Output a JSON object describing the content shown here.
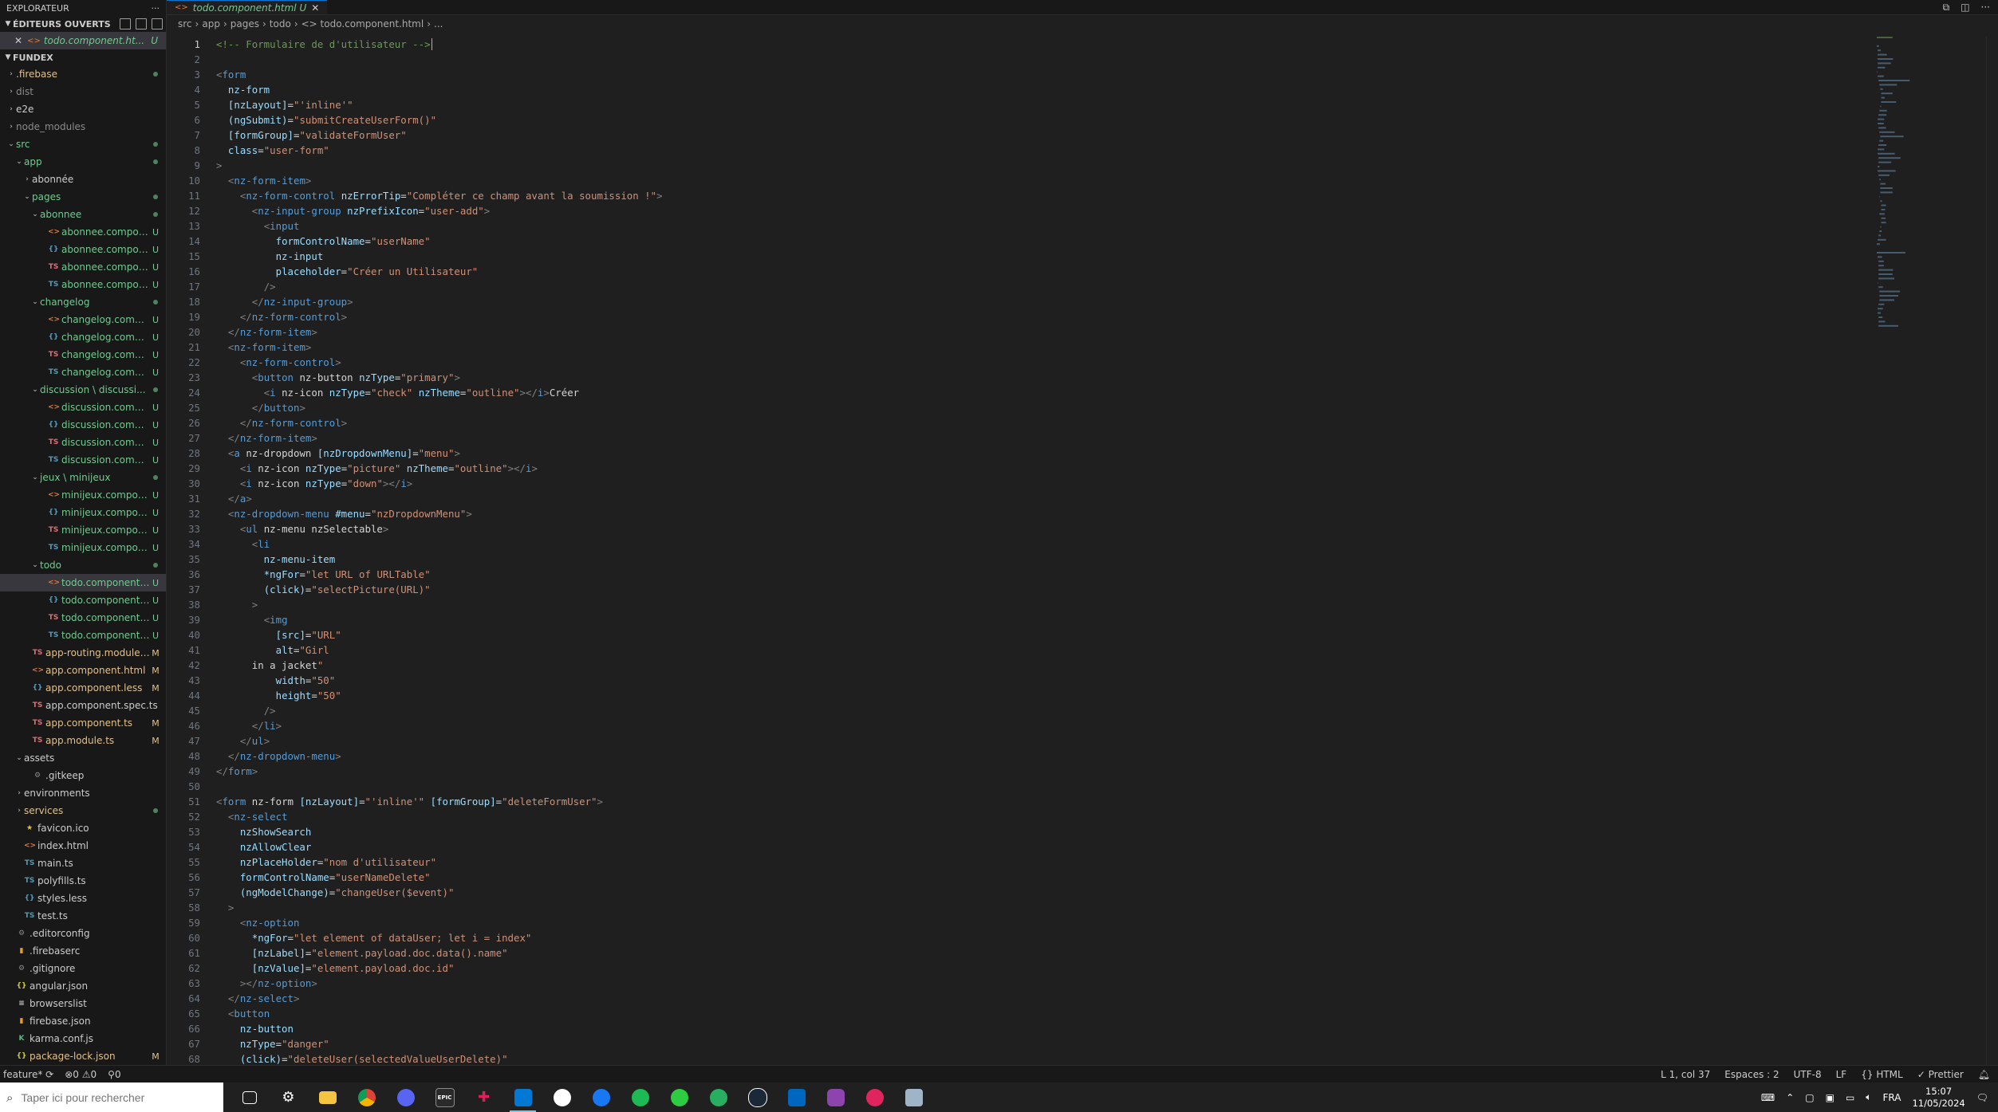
{
  "sidebar": {
    "title": "EXPLORATEUR",
    "open_editors_label": "ÉDITEURS OUVERTS",
    "open_editor_file": "todo.component.ht...",
    "open_editor_badge": "U",
    "project_label": "FUNDEX"
  },
  "tree": [
    {
      "depth": 0,
      "type": "folder",
      "label": ".firebase",
      "color": "mod",
      "dot": true,
      "open": false
    },
    {
      "depth": 0,
      "type": "folder",
      "label": "dist",
      "color": "dim",
      "open": false
    },
    {
      "depth": 0,
      "type": "folder",
      "label": "e2e",
      "color": "norm",
      "open": false
    },
    {
      "depth": 0,
      "type": "folder",
      "label": "node_modules",
      "color": "dim",
      "open": false
    },
    {
      "depth": 0,
      "type": "folder",
      "label": "src",
      "color": "git",
      "dot": true,
      "open": true
    },
    {
      "depth": 1,
      "type": "folder",
      "label": "app",
      "color": "git",
      "dot": true,
      "open": true
    },
    {
      "depth": 2,
      "type": "folder",
      "label": "abonnée",
      "color": "norm",
      "open": false
    },
    {
      "depth": 2,
      "type": "folder",
      "label": "pages",
      "color": "git",
      "dot": true,
      "open": true
    },
    {
      "depth": 3,
      "type": "folder",
      "label": "abonnee",
      "color": "git",
      "dot": true,
      "open": true
    },
    {
      "depth": 4,
      "type": "html",
      "label": "abonnee.compone...",
      "color": "git",
      "badge": "U"
    },
    {
      "depth": 4,
      "type": "less",
      "label": "abonnee.compone...",
      "color": "git",
      "badge": "U"
    },
    {
      "depth": 4,
      "type": "ts",
      "label": "abonnee.compone...",
      "color": "git",
      "badge": "U"
    },
    {
      "depth": 4,
      "type": "ts2",
      "label": "abonnee.compone...",
      "color": "git",
      "badge": "U"
    },
    {
      "depth": 3,
      "type": "folder",
      "label": "changelog",
      "color": "git",
      "dot": true,
      "open": true
    },
    {
      "depth": 4,
      "type": "html",
      "label": "changelog.compo...",
      "color": "git",
      "badge": "U"
    },
    {
      "depth": 4,
      "type": "less",
      "label": "changelog.compo...",
      "color": "git",
      "badge": "U"
    },
    {
      "depth": 4,
      "type": "ts",
      "label": "changelog.compo...",
      "color": "git",
      "badge": "U"
    },
    {
      "depth": 4,
      "type": "ts2",
      "label": "changelog.compo...",
      "color": "git",
      "badge": "U"
    },
    {
      "depth": 3,
      "type": "folder",
      "label": "discussion \\ discussi...",
      "color": "git",
      "dot": true,
      "open": true
    },
    {
      "depth": 4,
      "type": "html",
      "label": "discussion.compon...",
      "color": "git",
      "badge": "U"
    },
    {
      "depth": 4,
      "type": "less",
      "label": "discussion.compon...",
      "color": "git",
      "badge": "U"
    },
    {
      "depth": 4,
      "type": "ts",
      "label": "discussion.compon...",
      "color": "git",
      "badge": "U"
    },
    {
      "depth": 4,
      "type": "ts2",
      "label": "discussion.compon...",
      "color": "git",
      "badge": "U"
    },
    {
      "depth": 3,
      "type": "folder",
      "label": "jeux \\ minijeux",
      "color": "git",
      "dot": true,
      "open": true
    },
    {
      "depth": 4,
      "type": "html",
      "label": "minijeux.compone...",
      "color": "git",
      "badge": "U"
    },
    {
      "depth": 4,
      "type": "less",
      "label": "minijeux.compone...",
      "color": "git",
      "badge": "U"
    },
    {
      "depth": 4,
      "type": "ts",
      "label": "minijeux.compone...",
      "color": "git",
      "badge": "U"
    },
    {
      "depth": 4,
      "type": "ts2",
      "label": "minijeux.compone...",
      "color": "git",
      "badge": "U"
    },
    {
      "depth": 3,
      "type": "folder",
      "label": "todo",
      "color": "git",
      "dot": true,
      "open": true
    },
    {
      "depth": 4,
      "type": "html",
      "label": "todo.component.h...",
      "color": "git",
      "badge": "U",
      "selected": true
    },
    {
      "depth": 4,
      "type": "less",
      "label": "todo.component.le...",
      "color": "git",
      "badge": "U"
    },
    {
      "depth": 4,
      "type": "ts",
      "label": "todo.component.s...",
      "color": "git",
      "badge": "U"
    },
    {
      "depth": 4,
      "type": "ts2",
      "label": "todo.component.ts",
      "color": "git",
      "badge": "U"
    },
    {
      "depth": 2,
      "type": "ts",
      "label": "app-routing.module.ts",
      "color": "mod",
      "badge": "M"
    },
    {
      "depth": 2,
      "type": "html",
      "label": "app.component.html",
      "color": "mod",
      "badge": "M"
    },
    {
      "depth": 2,
      "type": "less",
      "label": "app.component.less",
      "color": "mod",
      "badge": "M"
    },
    {
      "depth": 2,
      "type": "ts",
      "label": "app.component.spec.ts",
      "color": "norm"
    },
    {
      "depth": 2,
      "type": "ts",
      "label": "app.component.ts",
      "color": "mod",
      "badge": "M"
    },
    {
      "depth": 2,
      "type": "ts",
      "label": "app.module.ts",
      "color": "mod",
      "badge": "M"
    },
    {
      "depth": 1,
      "type": "folder",
      "label": "assets",
      "color": "norm",
      "open": true
    },
    {
      "depth": 2,
      "type": "gear",
      "label": ".gitkeep",
      "color": "norm"
    },
    {
      "depth": 1,
      "type": "folder",
      "label": "environments",
      "color": "norm",
      "open": false
    },
    {
      "depth": 1,
      "type": "folder",
      "label": "services",
      "color": "mod",
      "dot": true,
      "open": false
    },
    {
      "depth": 1,
      "type": "star",
      "label": "favicon.ico",
      "color": "norm"
    },
    {
      "depth": 1,
      "type": "html",
      "label": "index.html",
      "color": "norm"
    },
    {
      "depth": 1,
      "type": "ts2",
      "label": "main.ts",
      "color": "norm"
    },
    {
      "depth": 1,
      "type": "ts2",
      "label": "polyfills.ts",
      "color": "norm"
    },
    {
      "depth": 1,
      "type": "less",
      "label": "styles.less",
      "color": "norm"
    },
    {
      "depth": 1,
      "type": "ts2",
      "label": "test.ts",
      "color": "norm"
    },
    {
      "depth": 0,
      "type": "gear",
      "label": ".editorconfig",
      "color": "norm"
    },
    {
      "depth": 0,
      "type": "fire",
      "label": ".firebaserc",
      "color": "norm"
    },
    {
      "depth": 0,
      "type": "gear",
      "label": ".gitignore",
      "color": "norm"
    },
    {
      "depth": 0,
      "type": "json",
      "label": "angular.json",
      "color": "norm"
    },
    {
      "depth": 0,
      "type": "list",
      "label": "browserslist",
      "color": "norm"
    },
    {
      "depth": 0,
      "type": "fire",
      "label": "firebase.json",
      "color": "norm"
    },
    {
      "depth": 0,
      "type": "karma",
      "label": "karma.conf.js",
      "color": "norm"
    },
    {
      "depth": 0,
      "type": "json",
      "label": "package-lock.json",
      "color": "mod",
      "badge": "M"
    }
  ],
  "editor": {
    "tab_label": "todo.component.html",
    "tab_badge": "U",
    "breadcrumb": [
      "src",
      "app",
      "pages",
      "todo",
      "todo.component.html",
      "..."
    ],
    "current_line": 1
  },
  "code_lines": [
    "<!-- Formulaire de d'utilisateur -->",
    "",
    "<form",
    "  nz-form",
    "  [nzLayout]=\"'inline'\"",
    "  (ngSubmit)=\"submitCreateUserForm()\"",
    "  [formGroup]=\"validateFormUser\"",
    "  class=\"user-form\"",
    ">",
    "  <nz-form-item>",
    "    <nz-form-control nzErrorTip=\"Compléter ce champ avant la soumission !\">",
    "      <nz-input-group nzPrefixIcon=\"user-add\">",
    "        <input",
    "          formControlName=\"userName\"",
    "          nz-input",
    "          placeholder=\"Créer un Utilisateur\"",
    "        />",
    "      </nz-input-group>",
    "    </nz-form-control>",
    "  </nz-form-item>",
    "  <nz-form-item>",
    "    <nz-form-control>",
    "      <button nz-button nzType=\"primary\">",
    "        <i nz-icon nzType=\"check\" nzTheme=\"outline\"></i>Créer",
    "      </button>",
    "    </nz-form-control>",
    "  </nz-form-item>",
    "  <a nz-dropdown [nzDropdownMenu]=\"menu\">",
    "    <i nz-icon nzType=\"picture\" nzTheme=\"outline\"></i>",
    "    <i nz-icon nzType=\"down\"></i>",
    "  </a>",
    "  <nz-dropdown-menu #menu=\"nzDropdownMenu\">",
    "    <ul nz-menu nzSelectable>",
    "      <li",
    "        nz-menu-item",
    "        *ngFor=\"let URL of URLTable\"",
    "        (click)=\"selectPicture(URL)\"",
    "      >",
    "        <img",
    "          [src]=\"URL\"",
    "          alt=\"Girl",
    "      in a jacket\"",
    "          width=\"50\"",
    "          height=\"50\"",
    "        />",
    "      </li>",
    "    </ul>",
    "  </nz-dropdown-menu>",
    "</form>",
    "",
    "<form nz-form [nzLayout]=\"'inline'\" [formGroup]=\"deleteFormUser\">",
    "  <nz-select",
    "    nzShowSearch",
    "    nzAllowClear",
    "    nzPlaceHolder=\"nom d'utilisateur\"",
    "    formControlName=\"userNameDelete\"",
    "    (ngModelChange)=\"changeUser($event)\"",
    "  >",
    "    <nz-option",
    "      *ngFor=\"let element of dataUser; let i = index\"",
    "      [nzLabel]=\"element.payload.doc.data().name\"",
    "      [nzValue]=\"element.payload.doc.id\"",
    "    ></nz-option>",
    "  </nz-select>",
    "  <button",
    "    nz-button",
    "    nzType=\"danger\"",
    "    (click)=\"deleteUser(selectedValueUserDelete)\""
  ],
  "statusbar": {
    "branch": "feature*",
    "errors": "0",
    "warnings": "0",
    "ports": "0",
    "cursor": "L 1, col 37",
    "spaces": "Espaces : 2",
    "encoding": "UTF-8",
    "eol": "LF",
    "language": "HTML",
    "formatter": "Prettier"
  },
  "taskbar": {
    "search_placeholder": "Taper ici pour rechercher",
    "lang": "FRA",
    "time": "15:07",
    "date": "11/05/2024"
  }
}
